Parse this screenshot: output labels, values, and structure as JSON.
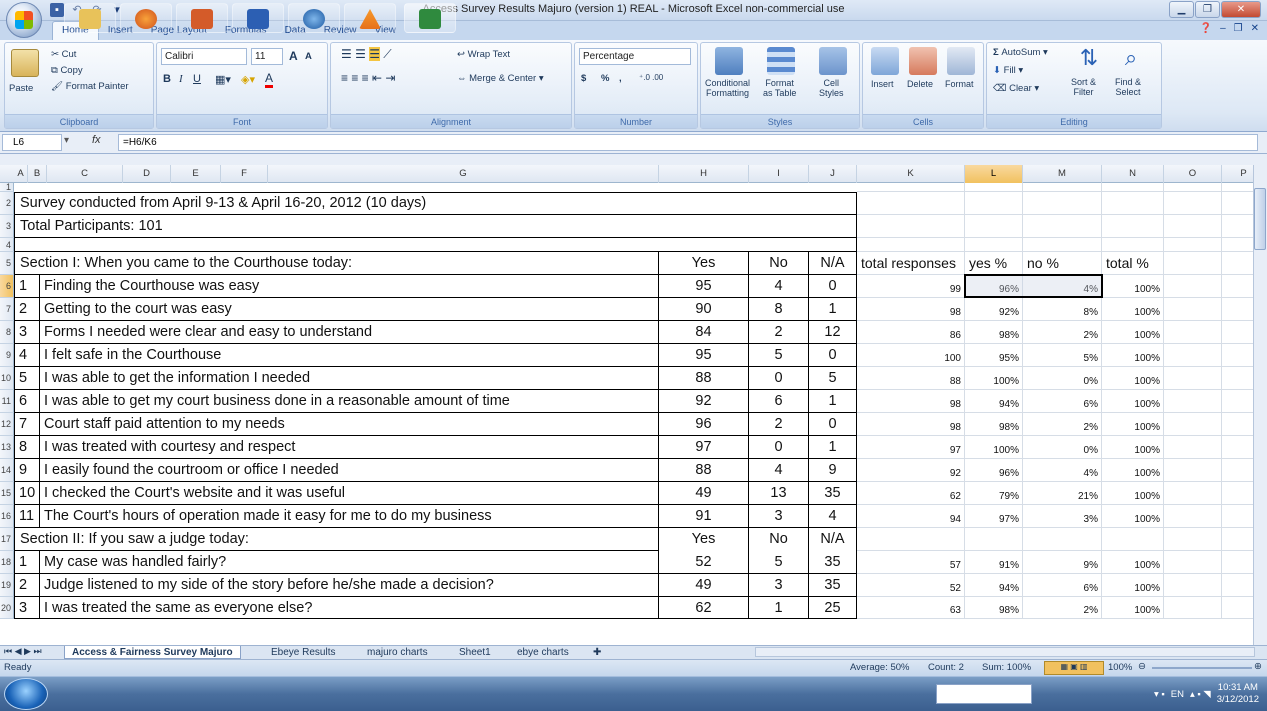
{
  "window": {
    "title": "Access Survey Results Majuro (version 1) REAL  -  Microsoft Excel non-commercial use",
    "controls": [
      "minimize",
      "maximize",
      "close"
    ]
  },
  "ribbon": {
    "tabs": [
      "Home",
      "Insert",
      "Page Layout",
      "Formulas",
      "Data",
      "Review",
      "View"
    ],
    "active_tab": "Home",
    "clipboard": {
      "paste": "Paste",
      "cut": "Cut",
      "copy": "Copy",
      "format_painter": "Format Painter",
      "label": "Clipboard"
    },
    "font": {
      "name": "Calibri",
      "size": "11",
      "label": "Font",
      "bold": "B",
      "italic": "I",
      "underline": "U",
      "grow": "A",
      "shrink": "A",
      "font_color": "A"
    },
    "alignment": {
      "wrap_text": "Wrap Text",
      "merge_center": "Merge & Center",
      "label": "Alignment"
    },
    "number": {
      "format": "Percentage",
      "currency": "$",
      "percent": "%",
      "comma": ",",
      "label": "Number"
    },
    "styles": {
      "conditional": "Conditional",
      "conditional2": "Formatting",
      "format_as": "Format",
      "format_as2": "as Table",
      "cell": "Cell",
      "cell2": "Styles",
      "label": "Styles"
    },
    "cells": {
      "insert": "Insert",
      "delete": "Delete",
      "format": "Format",
      "label": "Cells"
    },
    "editing": {
      "autosum": "AutoSum",
      "fill": "Fill",
      "clear": "Clear",
      "sort": "Sort &",
      "sort2": "Filter",
      "find": "Find &",
      "find2": "Select",
      "label": "Editing"
    }
  },
  "formula_bar": {
    "name_box": "L6",
    "fx": "fx",
    "formula": "=H6/K6"
  },
  "columns": [
    "A",
    "B",
    "C",
    "D",
    "E",
    "F",
    "G",
    "H",
    "I",
    "J",
    "K",
    "L",
    "M",
    "N",
    "O",
    "P"
  ],
  "selected_column": "L",
  "selected_row": "6",
  "rows": [
    {
      "n": "1"
    },
    {
      "n": "2",
      "text": "Survey conducted from April 9-13 & April 16-20, 2012  (10 days)"
    },
    {
      "n": "3",
      "text": "Total Participants:  101"
    },
    {
      "n": "4"
    },
    {
      "n": "5",
      "text": "Section I:  When you came to the Courthouse today:",
      "h": "Yes",
      "i": "No",
      "j": "N/A",
      "k": "total responses",
      "l": "yes %",
      "m": "no %",
      "nn": "total %"
    },
    {
      "n": "6",
      "num": "1",
      "text": "Finding the Courthouse was easy",
      "h": "95",
      "i": "4",
      "j": "0",
      "k": "99",
      "l": "96%",
      "m": "4%",
      "nn": "100%"
    },
    {
      "n": "7",
      "num": "2",
      "text": "Getting to the court was easy",
      "h": "90",
      "i": "8",
      "j": "1",
      "k": "98",
      "l": "92%",
      "m": "8%",
      "nn": "100%"
    },
    {
      "n": "8",
      "num": "3",
      "text": "Forms I needed were clear and easy to understand",
      "h": "84",
      "i": "2",
      "j": "12",
      "k": "86",
      "l": "98%",
      "m": "2%",
      "nn": "100%"
    },
    {
      "n": "9",
      "num": "4",
      "text": "I felt safe in the Courthouse",
      "h": "95",
      "i": "5",
      "j": "0",
      "k": "100",
      "l": "95%",
      "m": "5%",
      "nn": "100%"
    },
    {
      "n": "10",
      "num": "5",
      "text": "I was able to get the information I needed",
      "h": "88",
      "i": "0",
      "j": "5",
      "k": "88",
      "l": "100%",
      "m": "0%",
      "nn": "100%"
    },
    {
      "n": "11",
      "num": "6",
      "text": "I was able to get my court business done in a reasonable amount of time",
      "h": "92",
      "i": "6",
      "j": "1",
      "k": "98",
      "l": "94%",
      "m": "6%",
      "nn": "100%"
    },
    {
      "n": "12",
      "num": "7",
      "text": "Court staff paid attention to my needs",
      "h": "96",
      "i": "2",
      "j": "0",
      "k": "98",
      "l": "98%",
      "m": "2%",
      "nn": "100%"
    },
    {
      "n": "13",
      "num": "8",
      "text": "I was treated with courtesy and respect",
      "h": "97",
      "i": "0",
      "j": "1",
      "k": "97",
      "l": "100%",
      "m": "0%",
      "nn": "100%"
    },
    {
      "n": "14",
      "num": "9",
      "text": "I easily found the courtroom or office I needed",
      "h": "88",
      "i": "4",
      "j": "9",
      "k": "92",
      "l": "96%",
      "m": "4%",
      "nn": "100%"
    },
    {
      "n": "15",
      "num": "10",
      "text": "I checked the Court's website and it was useful",
      "h": "49",
      "i": "13",
      "j": "35",
      "k": "62",
      "l": "79%",
      "m": "21%",
      "nn": "100%"
    },
    {
      "n": "16",
      "num": "11",
      "text": "The Court's hours of operation made it easy for me to do my business",
      "h": "91",
      "i": "3",
      "j": "4",
      "k": "94",
      "l": "97%",
      "m": "3%",
      "nn": "100%"
    },
    {
      "n": "17",
      "text": "Section II:  If you saw a judge today:",
      "h": "Yes",
      "i": "No",
      "j": "N/A"
    },
    {
      "n": "18",
      "num": "1",
      "text": "My case was handled fairly?",
      "h": "52",
      "i": "5",
      "j": "35",
      "k": "57",
      "l": "91%",
      "m": "9%",
      "nn": "100%"
    },
    {
      "n": "19",
      "num": "2",
      "text": "Judge listened to my side of the story before he/she made a decision?",
      "h": "49",
      "i": "3",
      "j": "35",
      "k": "52",
      "l": "94%",
      "m": "6%",
      "nn": "100%"
    },
    {
      "n": "20",
      "num": "3",
      "text": "I was treated the same as everyone else?",
      "h": "62",
      "i": "1",
      "j": "25",
      "k": "63",
      "l": "98%",
      "m": "2%",
      "nn": "100%"
    }
  ],
  "sheet_tabs": [
    "Access & Fairness Survey Majuro",
    "Ebeye Results",
    "majuro charts",
    "Sheet1",
    "ebye charts"
  ],
  "active_sheet": "Access & Fairness Survey Majuro",
  "status": {
    "ready": "Ready",
    "average": "Average: 50%",
    "count": "Count: 2",
    "sum": "Sum: 100%",
    "zoom": "100%"
  },
  "tray": {
    "lang": "EN",
    "time": "10:31 AM",
    "date": "3/12/2012"
  },
  "colors": {
    "header_selected": "#f1c15f",
    "ribbon": "#dde8f5",
    "taskbar": "#4a6f9e"
  }
}
